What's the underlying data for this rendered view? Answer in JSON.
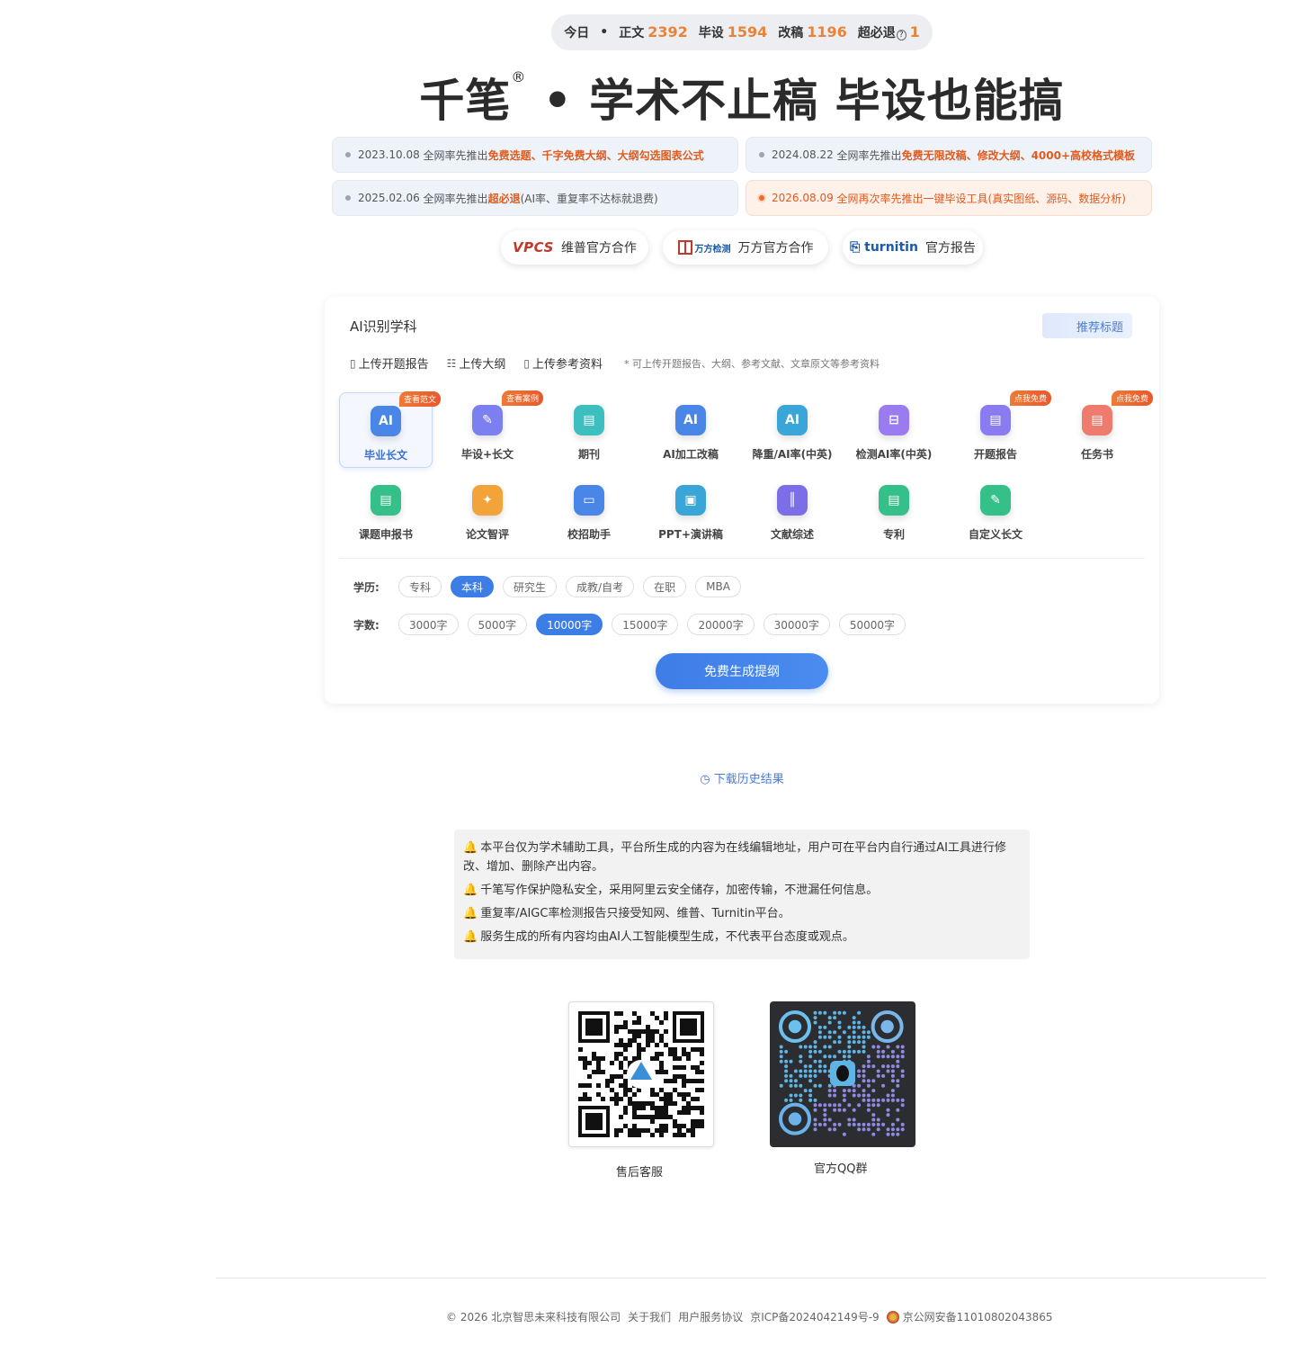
{
  "stats": {
    "today": "今日",
    "sep": "•",
    "items": [
      {
        "label": "正文",
        "value": "2392"
      },
      {
        "label": "毕设",
        "value": "1594"
      },
      {
        "label": "改稿",
        "value": "1196"
      },
      {
        "label": "超必退",
        "value": "1"
      }
    ],
    "question_icon": "?"
  },
  "hero": {
    "brand": "千笔",
    "reg": "®",
    "slogan": " • 学术不止稿  毕设也能搞"
  },
  "news": [
    {
      "date": "2023.10.08",
      "pre": "全网率先推出",
      "hl": "免费选题、千字免费大纲、大纲勾选图表公式",
      "post": ""
    },
    {
      "date": "2024.08.22",
      "pre": "全网率先推出",
      "hl": "免费无限改稿、修改大纲、4000+高校格式模板",
      "post": ""
    },
    {
      "date": "2025.02.06",
      "pre": "全网率先推出",
      "hl": "超必退",
      "post": "(AI率、重复率不达标就退费)"
    },
    {
      "date": "2026.08.09",
      "pre": "全网再次率先推出一键毕设工具(真实图纸、源码、数据分析)",
      "hl": "",
      "post": ""
    }
  ],
  "partners": [
    {
      "logo": "VPCS",
      "label": "维普官方合作"
    },
    {
      "logo": "万方检测",
      "label": "万方官方合作"
    },
    {
      "logo": "turnitin",
      "label": "官方报告"
    }
  ],
  "card": {
    "title": "AI识别学科",
    "recommend_btn": "推荐标题",
    "uploads": [
      "上传开题报告",
      "上传大纲",
      "上传参考资料"
    ],
    "upload_hint": "* 可上传开题报告、大纲、参考文献、文章原文等参考资料",
    "tiles": [
      {
        "label": "毕业长文",
        "badge": "查看范文",
        "icon": "doc-ai-icon",
        "color": "#4a86e8",
        "glyph": "AI"
      },
      {
        "label": "毕设+长文",
        "badge": "查看案例",
        "icon": "compass-icon",
        "color": "#7c7ff0",
        "glyph": "✎"
      },
      {
        "label": "期刊",
        "badge": "",
        "icon": "journal-icon",
        "color": "#3dbfc0",
        "glyph": "▤"
      },
      {
        "label": "AI加工改稿",
        "badge": "",
        "icon": "ai-edit-icon",
        "color": "#4a86e8",
        "glyph": "AI"
      },
      {
        "label": "降重/AI率(中英)",
        "badge": "",
        "icon": "reduce-icon",
        "color": "#3aa6d8",
        "glyph": "AI"
      },
      {
        "label": "检测AI率(中英)",
        "badge": "",
        "icon": "scan-icon",
        "color": "#9a7cf0",
        "glyph": "⊟"
      },
      {
        "label": "开题报告",
        "badge": "点我免费",
        "icon": "report-icon",
        "color": "#8a7cf0",
        "glyph": "▤"
      },
      {
        "label": "任务书",
        "badge": "点我免费",
        "icon": "task-icon",
        "color": "#ef7b6e",
        "glyph": "▤"
      },
      {
        "label": "课题申报书",
        "badge": "",
        "icon": "application-icon",
        "color": "#35c08a",
        "glyph": "▤"
      },
      {
        "label": "论文智评",
        "badge": "",
        "icon": "sparkle-icon",
        "color": "#f2a43a",
        "glyph": "✦"
      },
      {
        "label": "校招助手",
        "badge": "",
        "icon": "briefcase-icon",
        "color": "#4a86e8",
        "glyph": "▭"
      },
      {
        "label": "PPT+演讲稿",
        "badge": "",
        "icon": "presentation-icon",
        "color": "#3aa6d8",
        "glyph": "▣"
      },
      {
        "label": "文献综述",
        "badge": "",
        "icon": "library-icon",
        "color": "#7c6ee8",
        "glyph": "║"
      },
      {
        "label": "专利",
        "badge": "",
        "icon": "patent-icon",
        "color": "#35c08a",
        "glyph": "▤"
      },
      {
        "label": "自定义长文",
        "badge": "",
        "icon": "pen-icon",
        "color": "#35c08a",
        "glyph": "✎"
      }
    ],
    "edu_label": "学历:",
    "edu_options": [
      "专科",
      "本科",
      "研究生",
      "成教/自考",
      "在职",
      "MBA"
    ],
    "edu_selected": "本科",
    "words_label": "字数:",
    "word_options": [
      "3000字",
      "5000字",
      "10000字",
      "15000字",
      "20000字",
      "30000字",
      "50000字"
    ],
    "word_selected": "10000字",
    "generate_btn": "免费生成提纲"
  },
  "history_link": "下载历史结果",
  "notices": [
    "本平台仅为学术辅助工具，平台所生成的内容为在线编辑地址，用户可在平台内自行通过AI工具进行修改、增加、删除产出内容。",
    "千笔写作保护隐私安全，采用阿里云安全储存，加密传输，不泄漏任何信息。",
    "重复率/AIGC率检测报告只接受知网、维普、Turnitin平台。",
    "服务生成的所有内容均由AI人工智能模型生成，不代表平台态度或观点。"
  ],
  "qr": {
    "service_label": "售后客服",
    "group_label": "官方QQ群"
  },
  "footer": {
    "copyright": "© 2026 北京智思未来科技有限公司",
    "about": "关于我们",
    "agreement": "用户服务协议",
    "icp": "京ICP备2024042149号-9",
    "police": "京公网安备11010802043865"
  },
  "colors": {
    "accent": "#3d7de6",
    "highlight": "#e25a1c",
    "number": "#e8843a"
  }
}
